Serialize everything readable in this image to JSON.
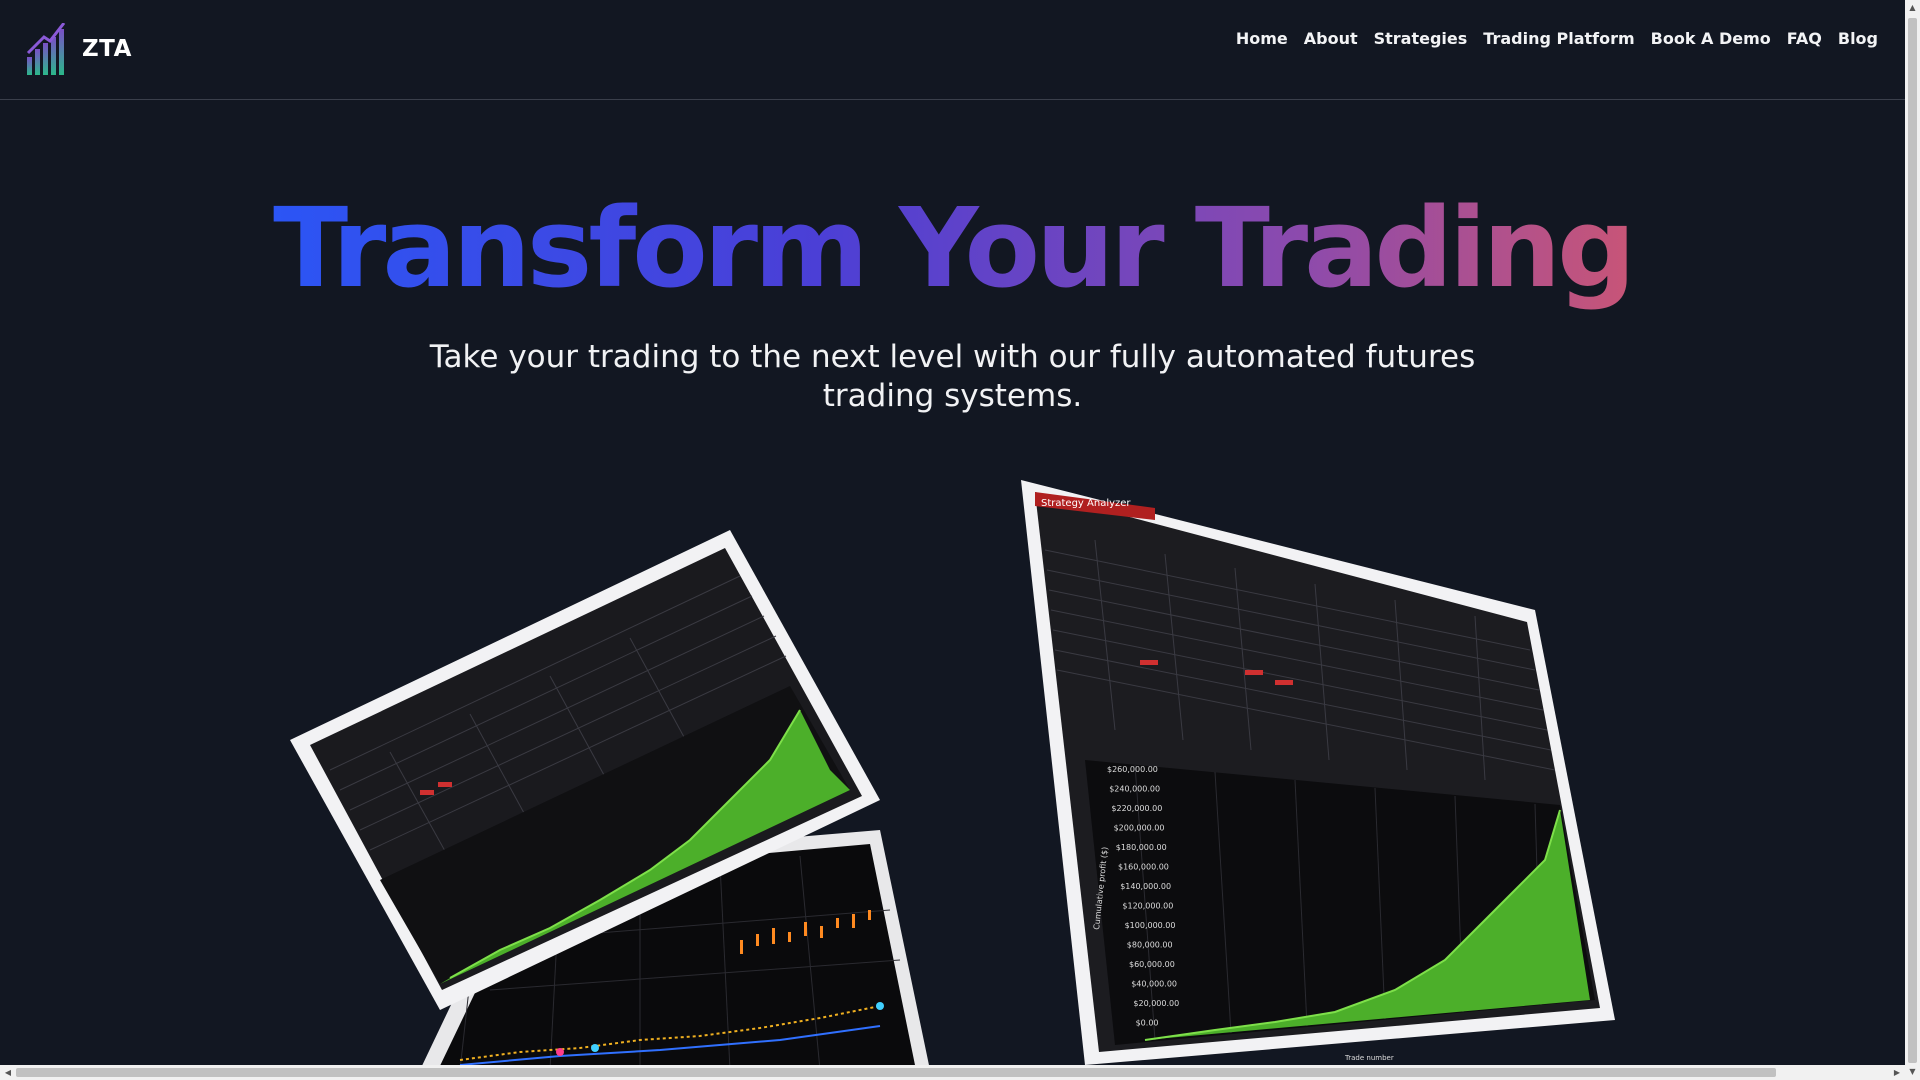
{
  "brand": {
    "name": "ZTA",
    "logo_icon": "rising-bars-logo-icon"
  },
  "nav": {
    "items": [
      {
        "label": "Home"
      },
      {
        "label": "About"
      },
      {
        "label": "Strategies"
      },
      {
        "label": "Trading Platform"
      },
      {
        "label": "Book A Demo"
      },
      {
        "label": "FAQ"
      },
      {
        "label": "Blog"
      }
    ]
  },
  "hero": {
    "title": "Transform Your Trading",
    "subtitle": "Take your trading to the next level with our fully automated futures trading systems."
  },
  "showcase": {
    "right_screen": {
      "window_title": "Strategy Analyzer",
      "y_axis_label": "Cumulative profit ($)",
      "x_axis_label": "Trade number",
      "y_ticks": [
        "$260,000.00",
        "$240,000.00",
        "$220,000.00",
        "$200,000.00",
        "$180,000.00",
        "$160,000.00",
        "$140,000.00",
        "$120,000.00",
        "$100,000.00",
        "$80,000.00",
        "$60,000.00",
        "$40,000.00",
        "$20,000.00",
        "$0.00"
      ]
    }
  },
  "colors": {
    "background": "#121722",
    "title_gradient_start": "#2b55f5",
    "title_gradient_end": "#c85577",
    "chart_green": "#4caf2a"
  }
}
